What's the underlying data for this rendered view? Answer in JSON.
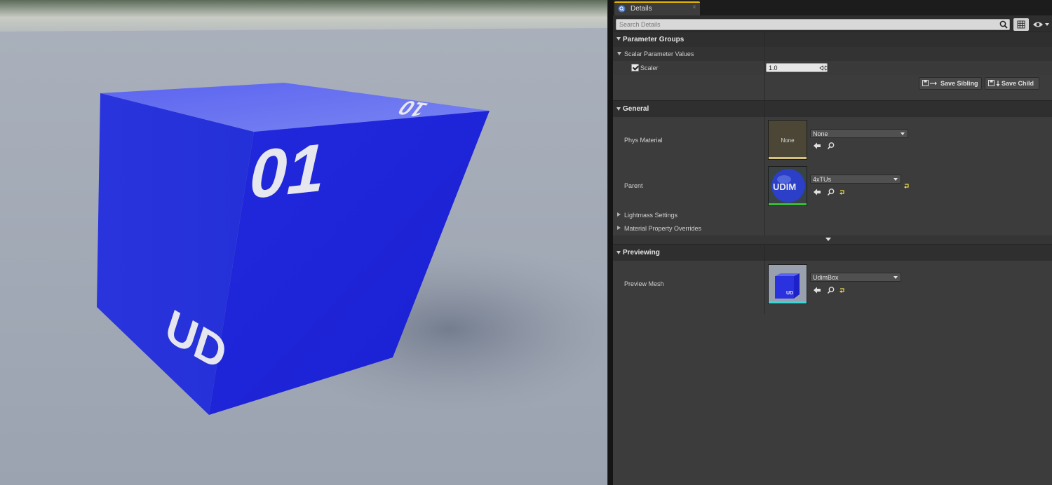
{
  "viewport": {
    "cube_texts": {
      "top": "10",
      "front": "01",
      "side": "UD"
    }
  },
  "tab": {
    "label": "Details",
    "close": "×"
  },
  "search": {
    "placeholder": "Search Details"
  },
  "categories": {
    "parameter_groups": "Parameter Groups",
    "general": "General",
    "previewing": "Previewing"
  },
  "scalar_group": {
    "label": "Scalar Parameter Values"
  },
  "scaler": {
    "label": "Scaler",
    "checked": true,
    "value": "1.0"
  },
  "buttons": {
    "save_sibling": "Save Sibling",
    "save_child": "Save Child"
  },
  "phys_material": {
    "label": "Phys Material",
    "thumb_text": "None",
    "selected": "None"
  },
  "parent": {
    "label": "Parent",
    "selected": "4xTUs",
    "thumb_text": "UDIM"
  },
  "lightmass": {
    "label": "Lightmass Settings"
  },
  "overrides": {
    "label": "Material Property Overrides"
  },
  "preview_mesh": {
    "label": "Preview Mesh",
    "selected": "UdimBox",
    "thumb_text": "UD"
  },
  "colors": {
    "tab_accent": "#e6b800",
    "cube_blue": "#2a2ee0",
    "reset_yellow": "#e8d84a",
    "phys_thumb_bar": "#d4c27a",
    "parent_thumb_bar": "#3bbf3b",
    "mesh_thumb_bar": "#3ad7d7"
  }
}
